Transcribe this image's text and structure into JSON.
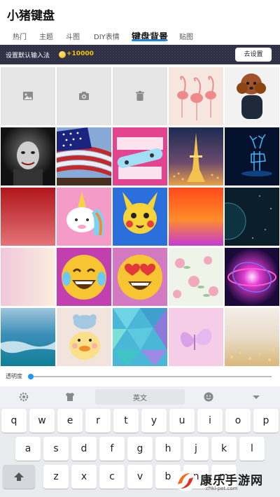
{
  "app": {
    "title": "小猪键盘"
  },
  "tabs": [
    {
      "label": "热门"
    },
    {
      "label": "主题"
    },
    {
      "label": "斗图"
    },
    {
      "label": "DIY表情"
    },
    {
      "label": "键盘背景"
    },
    {
      "label": "贴图"
    }
  ],
  "active_tab": "键盘背景",
  "banner": {
    "text": "设置默认输入法",
    "coin_amount": "+10000",
    "button_label": "去设置"
  },
  "tools": [
    {
      "icon": "image-icon"
    },
    {
      "icon": "camera-icon"
    },
    {
      "icon": "trash-icon"
    }
  ],
  "backgrounds": [
    {
      "name": "bg-flamingos"
    },
    {
      "name": "bg-poodle-dog"
    },
    {
      "name": "bg-clown-dark"
    },
    {
      "name": "bg-american-flag"
    },
    {
      "name": "bg-skateboard-sequin"
    },
    {
      "name": "bg-eiffel-tower-night"
    },
    {
      "name": "bg-blue-neon-deer"
    },
    {
      "name": "bg-red-gradient"
    },
    {
      "name": "bg-unicorn-sequin"
    },
    {
      "name": "bg-pikachu-sequin"
    },
    {
      "name": "bg-orange-red-gradient"
    },
    {
      "name": "bg-space-planet"
    },
    {
      "name": "bg-peach-gradient"
    },
    {
      "name": "bg-laughing-emoji-sequin"
    },
    {
      "name": "bg-heart-eyes-emoji-sequin"
    },
    {
      "name": "bg-floral-pastel"
    },
    {
      "name": "bg-neon-galaxy-swirl"
    },
    {
      "name": "bg-ocean-water"
    },
    {
      "name": "bg-duck-toy"
    },
    {
      "name": "bg-geometric-teal"
    },
    {
      "name": "bg-pink-butterfly"
    },
    {
      "name": "bg-gold-glitter"
    }
  ],
  "slider": {
    "label": "透明度",
    "value_fraction": 0.0
  },
  "keyboard": {
    "language": "英文",
    "row1": [
      "q",
      "w",
      "e",
      "r",
      "t",
      "y",
      "u",
      "i",
      "o",
      "p"
    ],
    "row2": [
      "a",
      "s",
      "d",
      "f",
      "g",
      "h",
      "j",
      "k",
      "l"
    ],
    "row3": [
      "z",
      "x",
      "c",
      "v",
      "b",
      "n",
      "m"
    ]
  },
  "watermark": {
    "text": "康乐手游网",
    "url": "chkl-pet.com"
  }
}
